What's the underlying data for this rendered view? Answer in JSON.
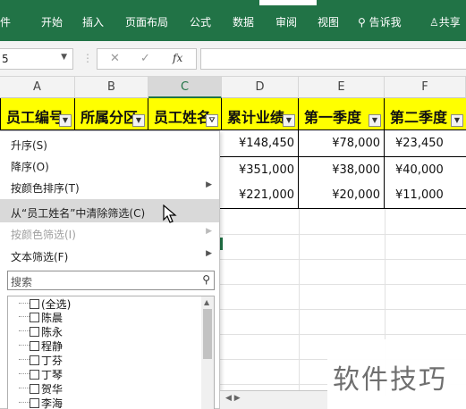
{
  "ribbon": {
    "tabs": [
      "文件",
      "开始",
      "插入",
      "页面布局",
      "公式",
      "数据",
      "审阅",
      "视图",
      "告诉我",
      "共享"
    ]
  },
  "formula_bar": {
    "name_box": "5",
    "cancel": "✕",
    "enter": "✓",
    "fx": "fx"
  },
  "columns": [
    "A",
    "B",
    "C",
    "D",
    "E",
    "F"
  ],
  "header_row": [
    "员工编号",
    "所属分区",
    "员工姓名",
    "累计业绩",
    "第一季度",
    "第二季度"
  ],
  "rows": [
    [
      "¥148,450",
      "¥78,000",
      "¥23,450"
    ],
    [
      "¥351,000",
      "¥38,000",
      "¥40,000"
    ],
    [
      "¥221,000",
      "¥20,000",
      "¥11,000"
    ]
  ],
  "filter_menu": {
    "sort_asc": "升序(S)",
    "sort_desc": "降序(O)",
    "sort_by_color": "按颜色排序(T)",
    "clear_filter": "从“员工姓名”中清除筛选(C)",
    "filter_by_color": "按颜色筛选(I)",
    "text_filter": "文本筛选(F)",
    "search_placeholder": "搜索",
    "items": [
      "(全选)",
      "陈晨",
      "陈永",
      "程静",
      "丁芬",
      "丁琴",
      "贺华",
      "李海"
    ]
  },
  "watermark": "软件技巧",
  "colors": {
    "ribbon": "#217346",
    "header_fill": "#ffff00",
    "hover": "#d9d9d9"
  }
}
